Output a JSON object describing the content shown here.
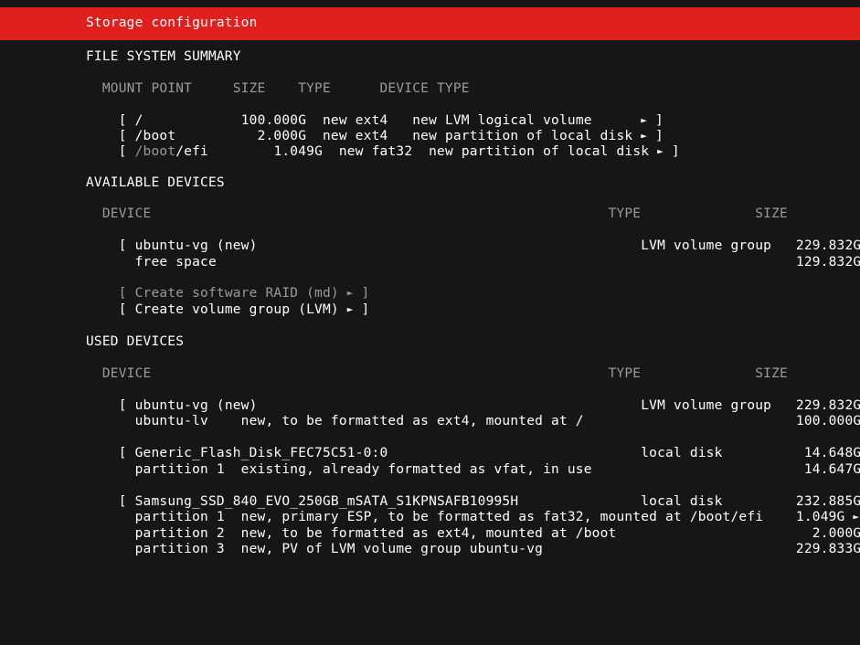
{
  "app": {
    "title": "Storage configuration"
  },
  "sections": {
    "fs_summary": "FILE SYSTEM SUMMARY",
    "available": "AVAILABLE DEVICES",
    "used": "USED DEVICES"
  },
  "fs_summary": {
    "header": "  MOUNT POINT     SIZE    TYPE      DEVICE TYPE",
    "rows": [
      {
        "bracket_l": "[ ",
        "mount": "/",
        "rest": "            100.000G  new ext4   new LVM logical volume      ",
        "arrow": "►",
        "bracket_r": " ]"
      },
      {
        "bracket_l": "[ ",
        "mount": "/boot",
        "rest": "          2.000G  new ext4   new partition of local disk ",
        "arrow": "►",
        "bracket_r": " ]"
      },
      {
        "bracket_l": "[ ",
        "mount_dim": "/boot",
        "mount": "/efi",
        "rest": "        1.049G  new fat32  new partition of local disk ",
        "arrow": "►",
        "bracket_r": " ]"
      }
    ]
  },
  "available": {
    "header": "  DEVICE                                                        TYPE              SIZE",
    "rows": [
      {
        "text": "[ ubuntu-vg (new)                                               LVM volume group   229.832G ",
        "arrow": "►",
        "end": " ]"
      },
      {
        "text": "  free space                                                                       129.832G ",
        "arrow": "►",
        "end": ""
      }
    ],
    "actions": [
      {
        "label": "[ Create software RAID (md) ",
        "arrow": "►",
        "end": " ]",
        "disabled": true
      },
      {
        "label": "[ Create volume group (LVM) ",
        "arrow": "►",
        "end": " ]",
        "disabled": false
      }
    ]
  },
  "used": {
    "header": "  DEVICE                                                        TYPE              SIZE",
    "groups": [
      [
        {
          "text": "[ ubuntu-vg (new)                                               LVM volume group   229.832G ",
          "arrow": "►",
          "end": " ]"
        },
        {
          "text": "  ubuntu-lv    new, to be formatted as ext4, mounted at /                          100.000G ",
          "arrow": "►",
          "end": ""
        }
      ],
      [
        {
          "text": "[ Generic_Flash_Disk_FEC75C51-0:0                               local disk          14.648G ",
          "arrow": "►",
          "end": " ]"
        },
        {
          "text": "  partition 1  existing, already formatted as vfat, in use                          14.647G ",
          "arrow": "►",
          "end": ""
        }
      ],
      [
        {
          "text": "[ Samsung_SSD_840_EVO_250GB_mSATA_S1KPNSAFB10995H               local disk         232.885G ",
          "arrow": "►",
          "end": " ]"
        },
        {
          "text": "  partition 1  new, primary ESP, to be formatted as fat32, mounted at /boot/efi    1.049G ",
          "arrow": "►",
          "end": ""
        },
        {
          "text": "  partition 2  new, to be formatted as ext4, mounted at /boot                        2.000G ",
          "arrow": "►",
          "end": ""
        },
        {
          "text": "  partition 3  new, PV of LVM volume group ubuntu-vg                               229.833G ",
          "arrow": "►",
          "end": ""
        }
      ]
    ]
  },
  "colors": {
    "accent": "#e01f1f",
    "background": "#161616",
    "text": "#ffffff",
    "dim": "#9a9a9a"
  }
}
